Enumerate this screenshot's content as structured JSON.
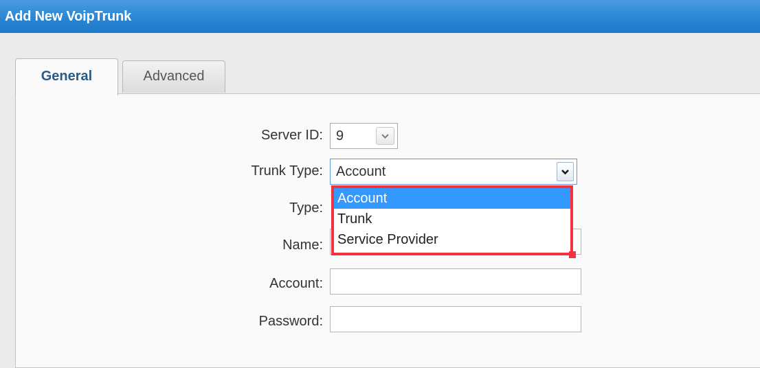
{
  "window": {
    "title": "Add New VoipTrunk"
  },
  "tabs": [
    {
      "label": "General",
      "active": true
    },
    {
      "label": "Advanced",
      "active": false
    }
  ],
  "form": {
    "server_id": {
      "label": "Server ID:",
      "value": "9"
    },
    "trunk_type": {
      "label": "Trunk Type:",
      "value": "Account",
      "options": [
        "Account",
        "Trunk",
        "Service Provider"
      ],
      "highlighted_option": "Account"
    },
    "type": {
      "label": "Type:"
    },
    "name": {
      "label": "Name:",
      "value": ""
    },
    "account": {
      "label": "Account:",
      "value": ""
    },
    "password": {
      "label": "Password:",
      "value": ""
    }
  },
  "icons": {
    "server_select_arrow": "chevron-down-icon",
    "trunk_select_arrow": "chevron-down-icon"
  },
  "colors": {
    "title_bar": "#2a86d4",
    "selected_option": "#3399ff",
    "highlight_border": "#f2333f",
    "active_tab_text": "#2b5a86"
  }
}
